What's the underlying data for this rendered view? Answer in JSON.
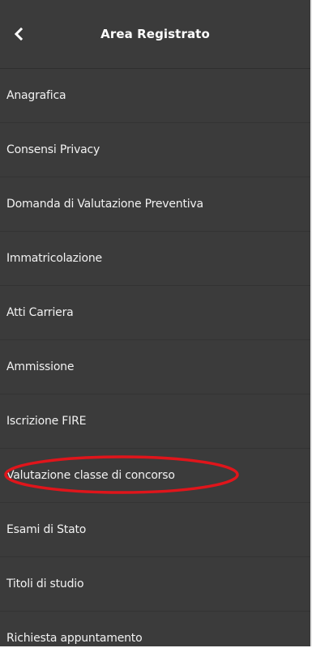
{
  "header": {
    "title": "Area Registrato",
    "back_icon": "chevron-left-icon"
  },
  "menu": {
    "items": [
      {
        "label": "Anagrafica"
      },
      {
        "label": "Consensi Privacy"
      },
      {
        "label": "Domanda di Valutazione Preventiva"
      },
      {
        "label": "Immatricolazione"
      },
      {
        "label": "Atti Carriera"
      },
      {
        "label": "Ammissione"
      },
      {
        "label": "Iscrizione FIRE"
      },
      {
        "label": "Valutazione classe di concorso",
        "annotation": "red-ellipse-highlight"
      },
      {
        "label": "Esami di Stato"
      },
      {
        "label": "Titoli di studio"
      },
      {
        "label": "Richiesta appuntamento"
      }
    ]
  },
  "colors": {
    "panel_background": "#3b3b3b",
    "text": "#f2f2f2",
    "highlight": "#e0151b"
  }
}
